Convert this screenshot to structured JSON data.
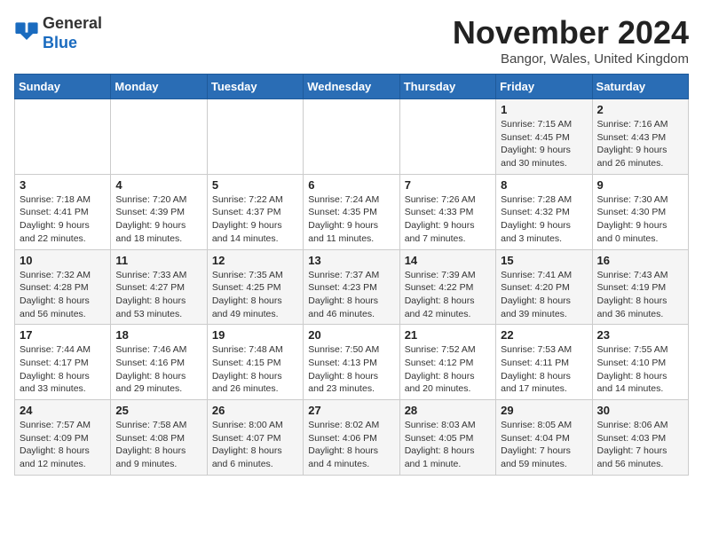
{
  "logo": {
    "general": "General",
    "blue": "Blue"
  },
  "title": "November 2024",
  "location": "Bangor, Wales, United Kingdom",
  "days_of_week": [
    "Sunday",
    "Monday",
    "Tuesday",
    "Wednesday",
    "Thursday",
    "Friday",
    "Saturday"
  ],
  "weeks": [
    [
      {
        "day": "",
        "info": ""
      },
      {
        "day": "",
        "info": ""
      },
      {
        "day": "",
        "info": ""
      },
      {
        "day": "",
        "info": ""
      },
      {
        "day": "",
        "info": ""
      },
      {
        "day": "1",
        "info": "Sunrise: 7:15 AM\nSunset: 4:45 PM\nDaylight: 9 hours and 30 minutes."
      },
      {
        "day": "2",
        "info": "Sunrise: 7:16 AM\nSunset: 4:43 PM\nDaylight: 9 hours and 26 minutes."
      }
    ],
    [
      {
        "day": "3",
        "info": "Sunrise: 7:18 AM\nSunset: 4:41 PM\nDaylight: 9 hours and 22 minutes."
      },
      {
        "day": "4",
        "info": "Sunrise: 7:20 AM\nSunset: 4:39 PM\nDaylight: 9 hours and 18 minutes."
      },
      {
        "day": "5",
        "info": "Sunrise: 7:22 AM\nSunset: 4:37 PM\nDaylight: 9 hours and 14 minutes."
      },
      {
        "day": "6",
        "info": "Sunrise: 7:24 AM\nSunset: 4:35 PM\nDaylight: 9 hours and 11 minutes."
      },
      {
        "day": "7",
        "info": "Sunrise: 7:26 AM\nSunset: 4:33 PM\nDaylight: 9 hours and 7 minutes."
      },
      {
        "day": "8",
        "info": "Sunrise: 7:28 AM\nSunset: 4:32 PM\nDaylight: 9 hours and 3 minutes."
      },
      {
        "day": "9",
        "info": "Sunrise: 7:30 AM\nSunset: 4:30 PM\nDaylight: 9 hours and 0 minutes."
      }
    ],
    [
      {
        "day": "10",
        "info": "Sunrise: 7:32 AM\nSunset: 4:28 PM\nDaylight: 8 hours and 56 minutes."
      },
      {
        "day": "11",
        "info": "Sunrise: 7:33 AM\nSunset: 4:27 PM\nDaylight: 8 hours and 53 minutes."
      },
      {
        "day": "12",
        "info": "Sunrise: 7:35 AM\nSunset: 4:25 PM\nDaylight: 8 hours and 49 minutes."
      },
      {
        "day": "13",
        "info": "Sunrise: 7:37 AM\nSunset: 4:23 PM\nDaylight: 8 hours and 46 minutes."
      },
      {
        "day": "14",
        "info": "Sunrise: 7:39 AM\nSunset: 4:22 PM\nDaylight: 8 hours and 42 minutes."
      },
      {
        "day": "15",
        "info": "Sunrise: 7:41 AM\nSunset: 4:20 PM\nDaylight: 8 hours and 39 minutes."
      },
      {
        "day": "16",
        "info": "Sunrise: 7:43 AM\nSunset: 4:19 PM\nDaylight: 8 hours and 36 minutes."
      }
    ],
    [
      {
        "day": "17",
        "info": "Sunrise: 7:44 AM\nSunset: 4:17 PM\nDaylight: 8 hours and 33 minutes."
      },
      {
        "day": "18",
        "info": "Sunrise: 7:46 AM\nSunset: 4:16 PM\nDaylight: 8 hours and 29 minutes."
      },
      {
        "day": "19",
        "info": "Sunrise: 7:48 AM\nSunset: 4:15 PM\nDaylight: 8 hours and 26 minutes."
      },
      {
        "day": "20",
        "info": "Sunrise: 7:50 AM\nSunset: 4:13 PM\nDaylight: 8 hours and 23 minutes."
      },
      {
        "day": "21",
        "info": "Sunrise: 7:52 AM\nSunset: 4:12 PM\nDaylight: 8 hours and 20 minutes."
      },
      {
        "day": "22",
        "info": "Sunrise: 7:53 AM\nSunset: 4:11 PM\nDaylight: 8 hours and 17 minutes."
      },
      {
        "day": "23",
        "info": "Sunrise: 7:55 AM\nSunset: 4:10 PM\nDaylight: 8 hours and 14 minutes."
      }
    ],
    [
      {
        "day": "24",
        "info": "Sunrise: 7:57 AM\nSunset: 4:09 PM\nDaylight: 8 hours and 12 minutes."
      },
      {
        "day": "25",
        "info": "Sunrise: 7:58 AM\nSunset: 4:08 PM\nDaylight: 8 hours and 9 minutes."
      },
      {
        "day": "26",
        "info": "Sunrise: 8:00 AM\nSunset: 4:07 PM\nDaylight: 8 hours and 6 minutes."
      },
      {
        "day": "27",
        "info": "Sunrise: 8:02 AM\nSunset: 4:06 PM\nDaylight: 8 hours and 4 minutes."
      },
      {
        "day": "28",
        "info": "Sunrise: 8:03 AM\nSunset: 4:05 PM\nDaylight: 8 hours and 1 minute."
      },
      {
        "day": "29",
        "info": "Sunrise: 8:05 AM\nSunset: 4:04 PM\nDaylight: 7 hours and 59 minutes."
      },
      {
        "day": "30",
        "info": "Sunrise: 8:06 AM\nSunset: 4:03 PM\nDaylight: 7 hours and 56 minutes."
      }
    ]
  ]
}
